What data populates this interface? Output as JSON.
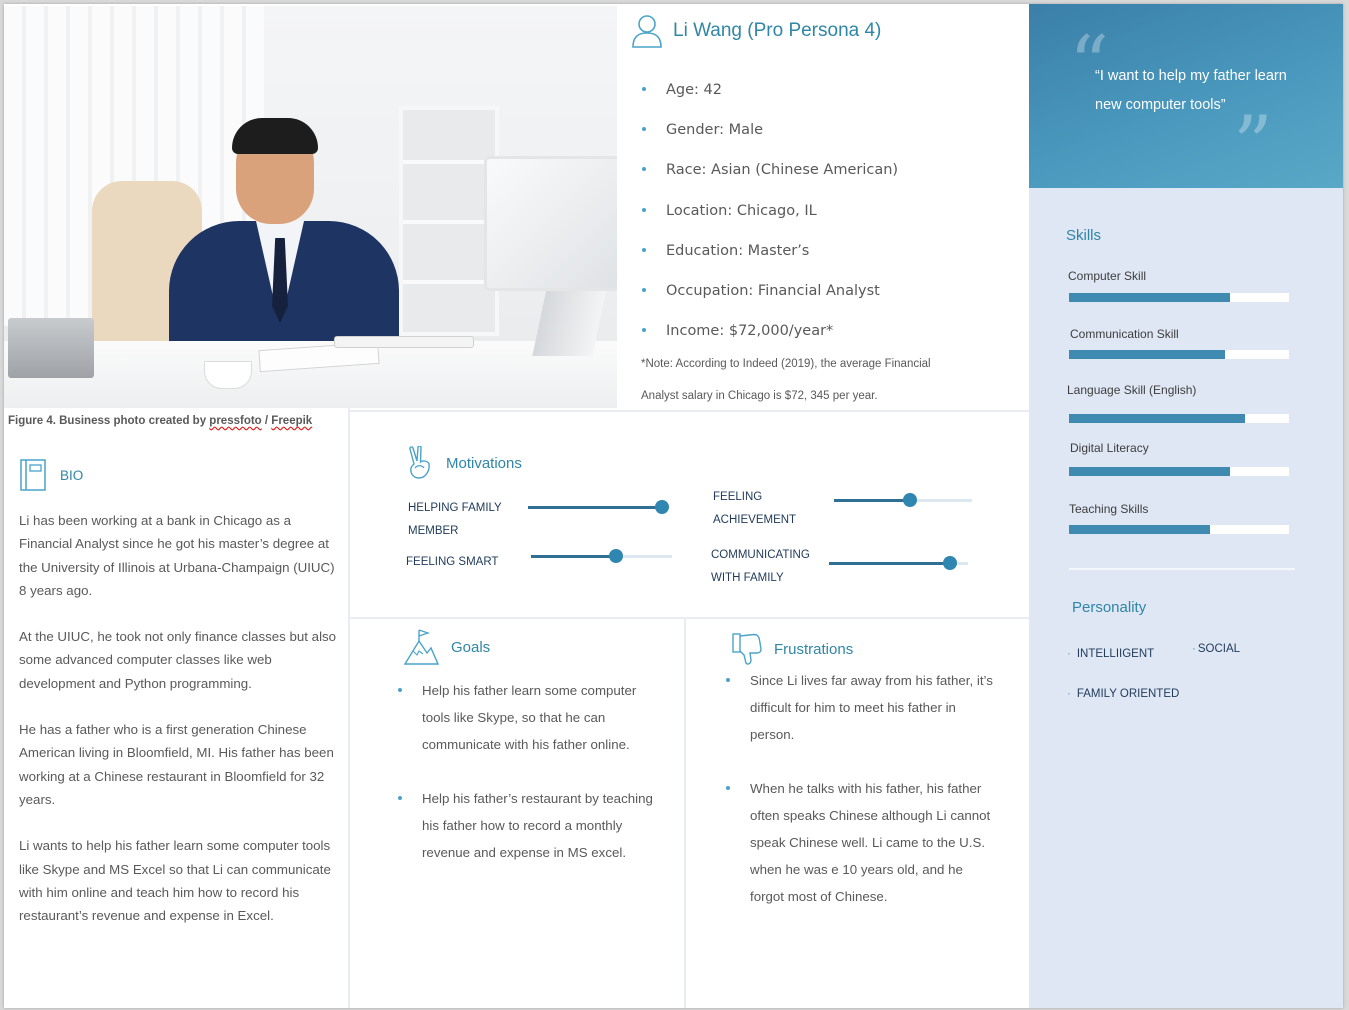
{
  "photo": {
    "description_icon": "photo-illustration",
    "credit_prefix": "Figure 4. Business photo created by ",
    "credit_author": "pressfoto",
    "credit_sep": " / ",
    "credit_source": "Freepik"
  },
  "persona": {
    "icon": "user-icon",
    "title": "Li Wang (Pro Persona 4)",
    "facts": [
      "Age: 42",
      "Gender: Male",
      "Race: Asian (Chinese American)",
      "Location: Chicago, IL",
      "Education: Master’s",
      "Occupation: Financial Analyst",
      "Income: $72,000/year*"
    ],
    "note_line1": "*Note: According to Indeed (2019), the average Financial",
    "note_line2": "Analyst salary in Chicago is $72, 345 per year."
  },
  "quote": {
    "open_mark": "“",
    "close_mark": "”",
    "text": "“I want to help my father learn new computer tools”"
  },
  "skills": {
    "heading": "Skills",
    "items": [
      {
        "label": "Computer Skill",
        "level": 0.73
      },
      {
        "label": "Communication Skill",
        "level": 0.71
      },
      {
        "label": "Language Skill (English)",
        "level": 0.8
      },
      {
        "label": "Digital Literacy",
        "level": 0.73
      },
      {
        "label": "Teaching Skills",
        "level": 0.64
      }
    ]
  },
  "personality": {
    "heading": "Personality",
    "traits": [
      "INTELLIIGENT",
      "SOCIAL",
      "FAMILY ORIENTED"
    ]
  },
  "bio": {
    "icon": "book-icon",
    "heading": "BIO",
    "paragraphs": [
      "Li has been working at a bank in Chicago as a Financial Analyst since he got his master’s degree at the University of Illinois at Urbana-Champaign (UIUC) 8 years ago.",
      "At the UIUC, he took not only finance classes but also some advanced computer classes like web development and Python programming.",
      "He has a father who is a first generation Chinese American living in Bloomfield, MI. His father has been working at a Chinese restaurant in Bloomfield for 32 years.",
      "Li wants to help his father learn some computer tools like Skype and MS Excel so that Li can communicate with him online and teach him how to record his restaurant’s revenue and expense in Excel."
    ]
  },
  "motivations": {
    "icon": "peace-hand-icon",
    "heading": "Motivations",
    "items": [
      {
        "label_line1": "HELPING FAMILY",
        "label_line2": "MEMBER",
        "level": 0.96
      },
      {
        "label_line1": "FEELING",
        "label_line2": "ACHIEVEMENT",
        "level": 0.55
      },
      {
        "label_line1": "FEELING SMART",
        "label_line2": "",
        "level": 0.6
      },
      {
        "label_line1": "COMMUNICATING",
        "label_line2": "WITH FAMILY",
        "level": 0.87
      }
    ]
  },
  "goals": {
    "icon": "mountain-flag-icon",
    "heading": "Goals",
    "items": [
      "Help his father learn some computer tools like Skype, so that he can communicate with his father online.",
      "Help his father’s restaurant by teaching his father how to record a monthly revenue and expense in MS excel."
    ]
  },
  "frustrations": {
    "icon": "thumbs-down-icon",
    "heading": "Frustrations",
    "items": [
      "Since Li lives far away from his father, it’s difficult for him to meet his father in person.",
      "When he talks with his father, his father often speaks Chinese although Li cannot speak Chinese well. Li came to the U.S. when he was e 10 years old, and he forgot most of Chinese."
    ]
  },
  "colors": {
    "accent": "#2f86a6",
    "bar_fill": "#3f8ab0",
    "side_panel": "#dfe7f4",
    "quote_panel": "#4a98bd"
  }
}
